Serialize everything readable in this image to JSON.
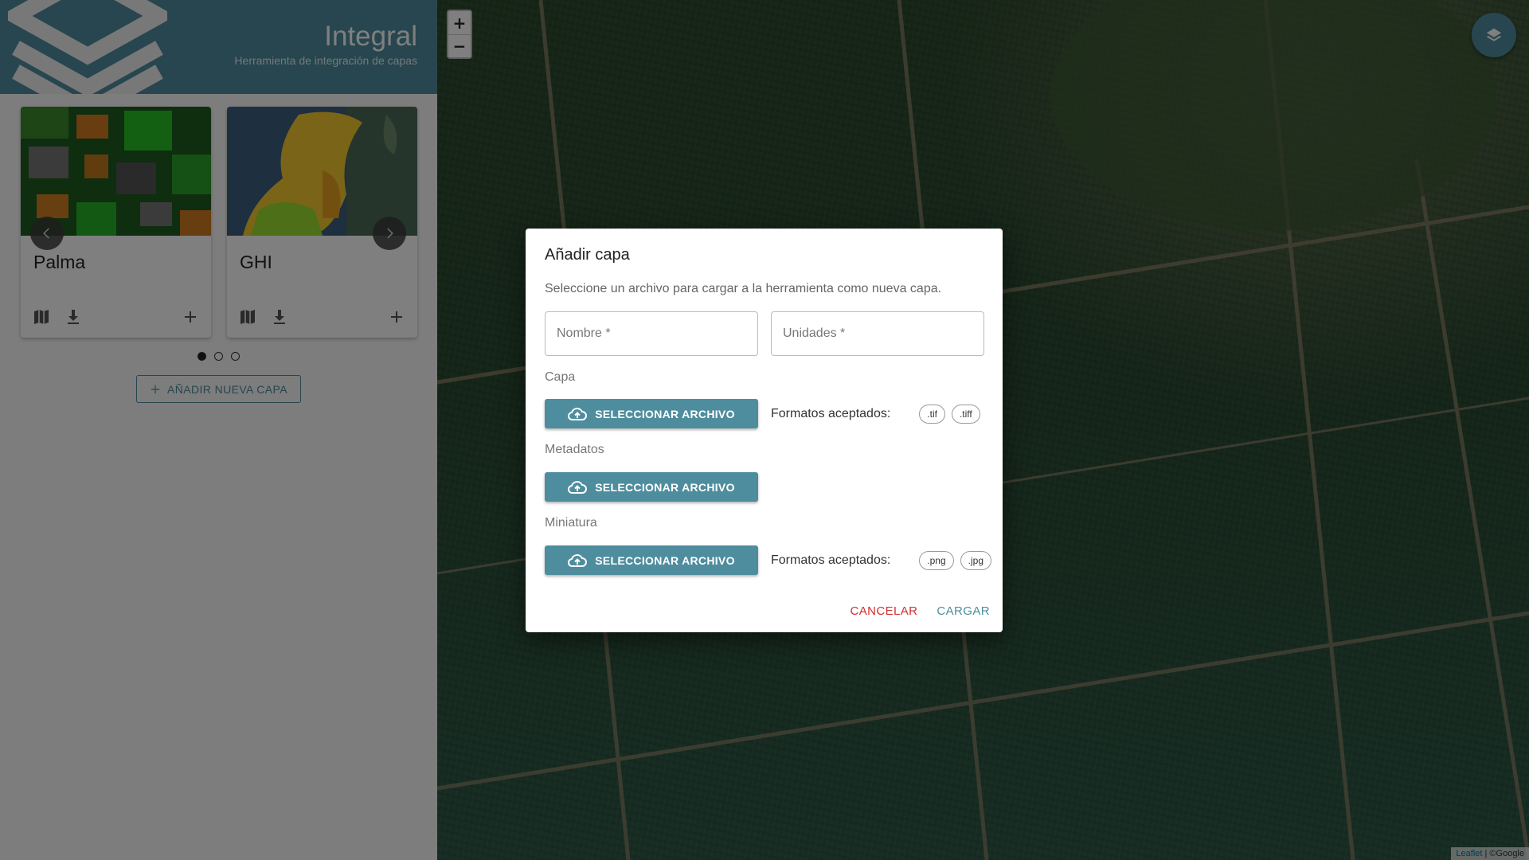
{
  "app": {
    "title": "Integral",
    "subtitle": "Herramienta de integración de capas"
  },
  "sidebar": {
    "cards": [
      {
        "title": "Palma",
        "icons": [
          "map-icon",
          "download-icon",
          "plus-icon"
        ]
      },
      {
        "title": "GHI",
        "icons": [
          "map-icon",
          "download-icon",
          "plus-icon"
        ]
      }
    ],
    "carousel": {
      "pages": 3,
      "active_page": 1,
      "prev_icon": "chevron-left-icon",
      "next_icon": "chevron-right-icon"
    },
    "add_layer_label": "AÑADIR NUEVA CAPA"
  },
  "map": {
    "zoom_in": "+",
    "zoom_out": "−",
    "attribution_link": "Leaflet",
    "attribution_rest": " | ©Google"
  },
  "dialog": {
    "title": "Añadir capa",
    "description": "Seleccione un archivo para cargar a la herramienta como nueva capa.",
    "name_placeholder": "Nombre *",
    "units_placeholder": "Unidades *",
    "sections": {
      "layer": {
        "label": "Capa",
        "button": "SELECCIONAR ARCHIVO",
        "formats_label": "Formatos aceptados:",
        "formats": [
          ".tif",
          ".tiff"
        ]
      },
      "metadata": {
        "label": "Metadatos",
        "button": "SELECCIONAR ARCHIVO"
      },
      "thumbnail": {
        "label": "Miniatura",
        "button": "SELECCIONAR ARCHIVO",
        "formats_label": "Formatos aceptados:",
        "formats": [
          ".png",
          ".jpg"
        ]
      }
    },
    "cancel_label": "CANCELAR",
    "load_label": "CARGAR"
  },
  "colors": {
    "accent": "#4e8d9e",
    "cancel": "#d32f2f"
  }
}
